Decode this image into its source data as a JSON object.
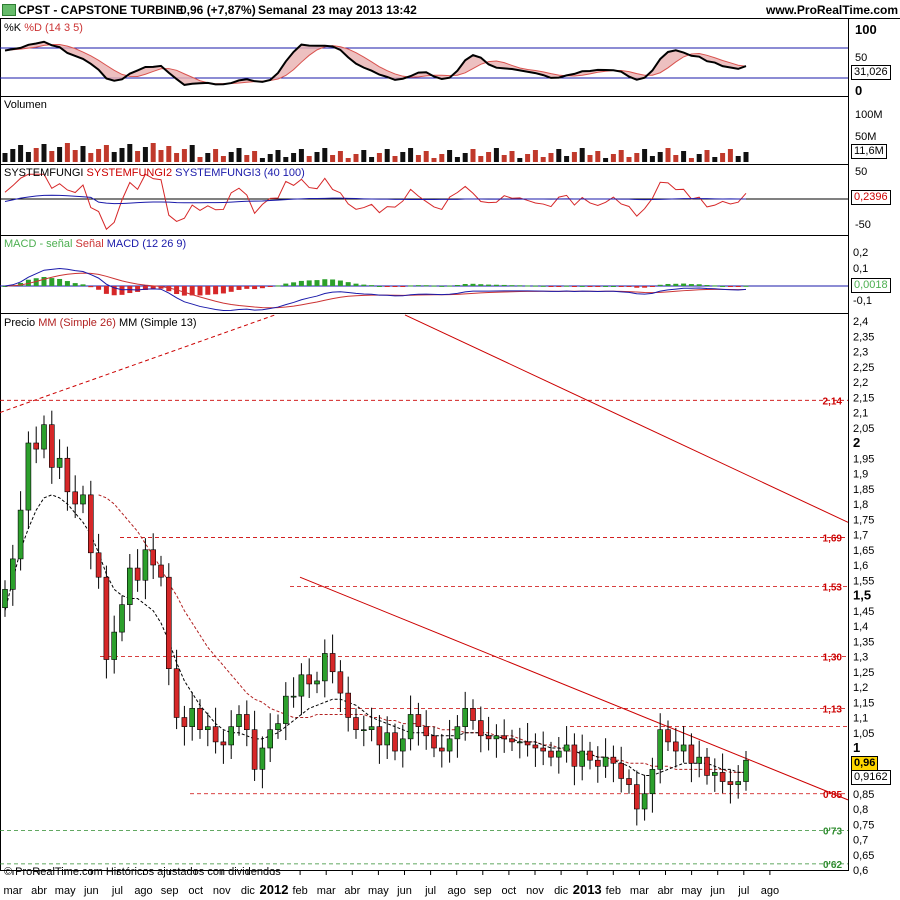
{
  "header": {
    "symbol": "CPST - CAPSTONE TURBINE",
    "price_change": "0,96 (+7,87%)",
    "period": "Semanal",
    "datetime": "23 may 2013 13:42",
    "site": "www.ProRealTime.com"
  },
  "footer": "© ProRealTime.com Históricos ajustados con dividendos",
  "colors": {
    "up": "#2ca02c",
    "down": "#d62728",
    "fib": "#cc0000",
    "ma26": "#b22222",
    "ma13": "#000000"
  },
  "panels": {
    "stoch": {
      "label_k": "%K",
      "label_d": "%D",
      "params": "(14 3 5)",
      "ticks": [
        "100",
        "50",
        "0"
      ],
      "value": "31,026"
    },
    "volume": {
      "title": "Volumen",
      "ticks": [
        "100M",
        "50M"
      ],
      "value": "11,6M"
    },
    "fungi": {
      "s1": "SYSTEMFUNGI",
      "s2": "SYSTEMFUNGI2",
      "s3": "SYSTEMFUNGI3",
      "params": "(40 100)",
      "ticks": [
        "50",
        "-50"
      ],
      "value": "0,2396"
    },
    "macd": {
      "s1": "MACD - señal",
      "s2": "Señal",
      "s3": "MACD",
      "params": "(12 26 9)",
      "ticks": [
        "0,2",
        "0,1",
        "-0,1"
      ],
      "value": "0,0018"
    },
    "price": {
      "title": "Precio",
      "ma26": "MM (Simple 26)",
      "ma13": "MM (Simple 13)",
      "last": "0,96",
      "ma_value": "0,9162"
    }
  },
  "chart_data": {
    "type": "candlestick",
    "symbol": "CPST",
    "ylim": [
      0.6,
      2.4
    ],
    "y_ticks": [
      2.4,
      2.35,
      2.3,
      2.25,
      2.2,
      2.15,
      2.1,
      2.05,
      2,
      1.95,
      1.9,
      1.85,
      1.8,
      1.75,
      1.7,
      1.65,
      1.6,
      1.55,
      1.5,
      1.45,
      1.4,
      1.35,
      1.3,
      1.25,
      1.2,
      1.15,
      1.1,
      1.05,
      1,
      0.95,
      0.9,
      0.85,
      0.8,
      0.75,
      0.7,
      0.65,
      0.6
    ],
    "y_tick_labels": [
      "2,4",
      "2,35",
      "2,3",
      "2,25",
      "2,2",
      "2,15",
      "2,1",
      "2,05",
      "2",
      "1,95",
      "1,9",
      "1,85",
      "1,8",
      "1,75",
      "1,7",
      "1,65",
      "1,6",
      "1,55",
      "1,5",
      "1,45",
      "1,4",
      "1,35",
      "1,3",
      "1,25",
      "1,2",
      "1,15",
      "1,1",
      "1,05",
      "1",
      "0,95",
      "0,9",
      "0,85",
      "0,8",
      "0,75",
      "0,7",
      "0,65",
      "0,6"
    ],
    "bold_ticks": [
      2,
      1.5,
      1
    ],
    "x_labels": [
      "mar",
      "abr",
      "may",
      "jun",
      "jul",
      "ago",
      "sep",
      "oct",
      "nov",
      "dic",
      "2012",
      "feb",
      "mar",
      "abr",
      "may",
      "jun",
      "jul",
      "ago",
      "sep",
      "oct",
      "nov",
      "dic",
      "2013",
      "feb",
      "mar",
      "abr",
      "may",
      "jun",
      "jul",
      "ago"
    ],
    "x_bold": [
      "2012",
      "2013"
    ],
    "levels": [
      {
        "value": 2.14,
        "label": "2,14",
        "color": "#cc0000",
        "show_line": false
      },
      {
        "value": 1.69,
        "label": "1,69",
        "color": "#cc0000",
        "show_line": false
      },
      {
        "value": 1.53,
        "label": "1,53",
        "color": "#cc0000",
        "show_line": false
      },
      {
        "value": 1.3,
        "label": "1,30",
        "color": "#cc0000",
        "show_line": false
      },
      {
        "value": 1.13,
        "label": "1,13",
        "color": "#cc0000",
        "show_line": false
      },
      {
        "value": 0.85,
        "label": "0'85",
        "color": "#cc0000",
        "show_line": false
      },
      {
        "value": 0.73,
        "label": "0'73",
        "color": "#2e8b2e",
        "show_line": true
      },
      {
        "value": 0.62,
        "label": "0'62",
        "color": "#2e8b2e",
        "show_line": true
      }
    ],
    "close": [
      1.52,
      1.62,
      1.78,
      2.0,
      1.98,
      2.06,
      1.92,
      1.95,
      1.84,
      1.8,
      1.83,
      1.64,
      1.56,
      1.29,
      1.38,
      1.47,
      1.59,
      1.55,
      1.65,
      1.6,
      1.56,
      1.26,
      1.1,
      1.07,
      1.13,
      1.06,
      1.07,
      1.02,
      1.01,
      1.07,
      1.11,
      1.06,
      0.93,
      1.0,
      1.06,
      1.08,
      1.17,
      1.17,
      1.24,
      1.21,
      1.22,
      1.31,
      1.25,
      1.18,
      1.1,
      1.06,
      1.06,
      1.07,
      1.01,
      1.05,
      0.99,
      1.03,
      1.11,
      1.07,
      1.04,
      1.0,
      0.99,
      1.03,
      1.07,
      1.13,
      1.09,
      1.04,
      1.03,
      1.04,
      1.03,
      1.02,
      1.02,
      1.01,
      1.0,
      0.99,
      0.97,
      0.99,
      1.01,
      0.94,
      0.99,
      0.96,
      0.94,
      0.97,
      0.95,
      0.9,
      0.88,
      0.8,
      0.85,
      0.93,
      1.06,
      1.02,
      0.99,
      1.01,
      0.95,
      0.97,
      0.91,
      0.92,
      0.89,
      0.88,
      0.89,
      0.96
    ],
    "ma13": [
      1.45,
      1.55,
      1.65,
      1.72,
      1.78,
      1.82,
      1.83,
      1.82,
      1.8,
      1.77,
      1.74,
      1.7,
      1.64,
      1.57,
      1.52,
      1.5,
      1.49,
      1.49,
      1.47,
      1.45,
      1.41,
      1.35,
      1.28,
      1.22,
      1.18,
      1.14,
      1.11,
      1.08,
      1.06,
      1.05,
      1.05,
      1.04,
      1.03,
      1.03,
      1.04,
      1.05,
      1.07,
      1.09,
      1.11,
      1.13,
      1.14,
      1.15,
      1.16,
      1.16,
      1.15,
      1.14,
      1.12,
      1.1,
      1.09,
      1.08,
      1.07,
      1.06,
      1.05,
      1.05,
      1.05,
      1.04,
      1.04,
      1.04,
      1.04,
      1.05,
      1.05,
      1.05,
      1.04,
      1.04,
      1.03,
      1.03,
      1.02,
      1.02,
      1.02,
      1.01,
      1.0,
      1.0,
      1.0,
      0.99,
      0.98,
      0.98,
      0.97,
      0.97,
      0.96,
      0.95,
      0.94,
      0.92,
      0.91,
      0.91,
      0.92,
      0.93,
      0.94,
      0.95,
      0.95,
      0.95,
      0.95,
      0.94,
      0.93,
      0.93,
      0.92,
      0.92
    ],
    "ma26_start": 12,
    "ma26": [
      1.83,
      1.82,
      1.8,
      1.77,
      1.74,
      1.71,
      1.67,
      1.63,
      1.59,
      1.54,
      1.5,
      1.45,
      1.41,
      1.37,
      1.33,
      1.3,
      1.27,
      1.24,
      1.21,
      1.18,
      1.16,
      1.15,
      1.13,
      1.12,
      1.11,
      1.1,
      1.1,
      1.1,
      1.11,
      1.11,
      1.11,
      1.11,
      1.11,
      1.11,
      1.11,
      1.1,
      1.1,
      1.09,
      1.09,
      1.08,
      1.08,
      1.08,
      1.07,
      1.07,
      1.06,
      1.06,
      1.06,
      1.05,
      1.05,
      1.05,
      1.05,
      1.04,
      1.04,
      1.04,
      1.03,
      1.02,
      1.02,
      1.01,
      1.01,
      1.0,
      0.99,
      0.99,
      0.98,
      0.98,
      0.97,
      0.97,
      0.96,
      0.96,
      0.95,
      0.95,
      0.95,
      0.94,
      0.94,
      0.94,
      0.93,
      0.93,
      0.93,
      0.93,
      0.93,
      0.93,
      0.93,
      0.92,
      0.92,
      0.92
    ]
  }
}
